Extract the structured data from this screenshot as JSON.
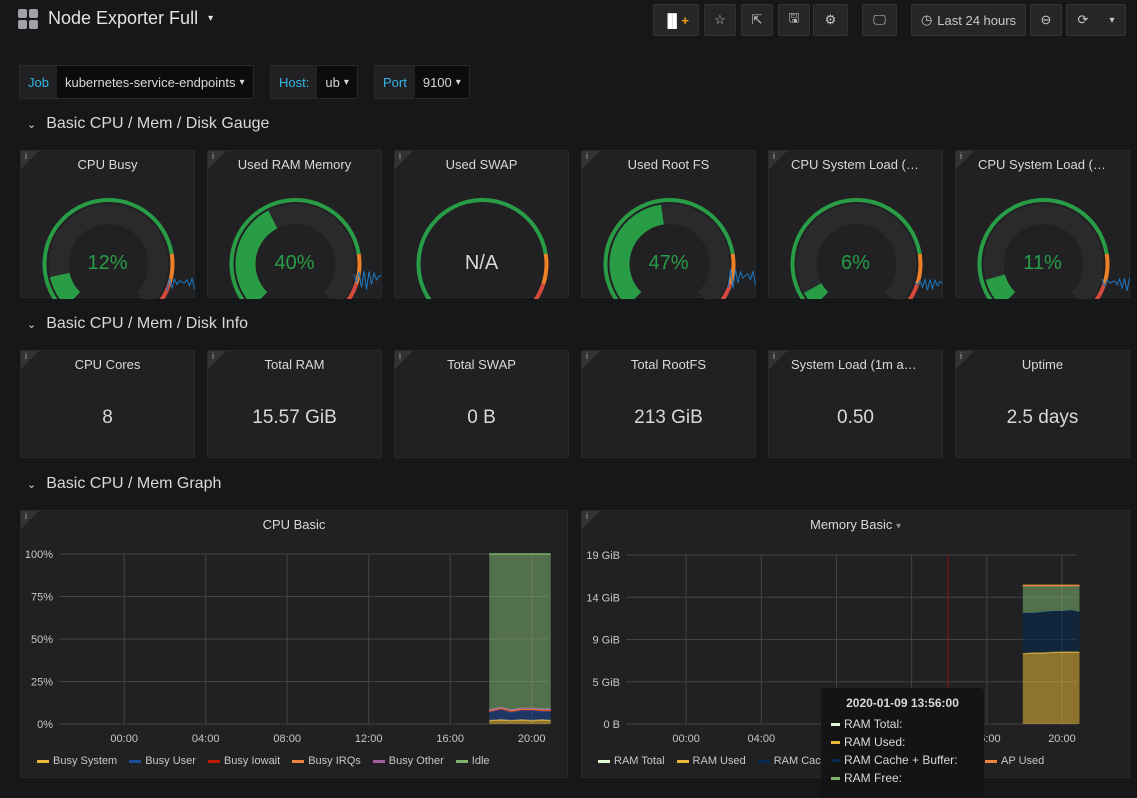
{
  "header": {
    "title": "Node Exporter Full",
    "time_range": "Last 24 hours",
    "buttons": [
      "add-panel",
      "star",
      "share",
      "save",
      "settings",
      "tv-mode"
    ]
  },
  "variables": [
    {
      "label": "Job",
      "value": "kubernetes-service-endpoints"
    },
    {
      "label": "Host:",
      "value": "ub"
    },
    {
      "label": "Port",
      "value": "9100"
    }
  ],
  "rows": [
    "Basic CPU / Mem / Disk Gauge",
    "Basic CPU / Mem / Disk Info",
    "Basic CPU / Mem Graph"
  ],
  "gauges": [
    {
      "title": "CPU Busy",
      "value": "12%",
      "percent": 12
    },
    {
      "title": "Used RAM Memory",
      "value": "40%",
      "percent": 40
    },
    {
      "title": "Used SWAP",
      "value": "N/A",
      "percent": null
    },
    {
      "title": "Used Root FS",
      "value": "47%",
      "percent": 47
    },
    {
      "title": "CPU System Load (1...",
      "value": "6%",
      "percent": 6
    },
    {
      "title": "CPU System Load (5...",
      "value": "11%",
      "percent": 11
    }
  ],
  "colors": {
    "green": "#299c46",
    "orange": "#ed8128",
    "red": "#d44a3a",
    "accent": "#33b5e5"
  },
  "stats": [
    {
      "title": "CPU Cores",
      "value": "8"
    },
    {
      "title": "Total RAM",
      "value": "15.57 GiB"
    },
    {
      "title": "Total SWAP",
      "value": "0 B"
    },
    {
      "title": "Total RootFS",
      "value": "213 GiB"
    },
    {
      "title": "System Load (1m avg)",
      "value": "0.50"
    },
    {
      "title": "Uptime",
      "value": "2.5 days"
    }
  ],
  "chart_data": [
    {
      "type": "area",
      "title": "CPU Basic",
      "ylim": [
        0,
        100
      ],
      "yticks": [
        "0%",
        "25%",
        "50%",
        "75%",
        "100%"
      ],
      "ytick_values": [
        0,
        25,
        50,
        75,
        100
      ],
      "xticks": [
        "00:00",
        "04:00",
        "08:00",
        "12:00",
        "16:00",
        "20:00"
      ],
      "xrange": [
        "20:48",
        "20:56"
      ],
      "stacked": true,
      "x": [
        "17:55",
        "18:30",
        "19:00",
        "19:30",
        "20:00",
        "20:30",
        "20:56"
      ],
      "series": [
        {
          "name": "Busy System",
          "color": "#eab839",
          "values": [
            2,
            2.5,
            2,
            2.5,
            2,
            2.5,
            2
          ]
        },
        {
          "name": "Busy User",
          "color": "#1f4b99",
          "values": [
            5,
            6,
            5,
            5.5,
            6,
            5,
            5.5
          ]
        },
        {
          "name": "Busy Iowait",
          "color": "#bf1b00",
          "values": [
            0.5,
            0.5,
            0.5,
            0.5,
            0.5,
            0.5,
            0.5
          ]
        },
        {
          "name": "Busy IRQs",
          "color": "#ef843c",
          "values": [
            0.3,
            0.3,
            0.3,
            0.3,
            0.3,
            0.3,
            0.3
          ]
        },
        {
          "name": "Busy Other",
          "color": "#a05da0",
          "values": [
            0.5,
            0.5,
            0.5,
            0.5,
            0.5,
            0.5,
            0.5
          ]
        },
        {
          "name": "Idle",
          "color": "#7eb26d",
          "values": [
            91.7,
            90.2,
            91.7,
            90.7,
            90.7,
            91.2,
            91.2
          ]
        }
      ]
    },
    {
      "type": "area",
      "title": "Memory Basic",
      "ylim": [
        0,
        19
      ],
      "yticks": [
        "0 B",
        "5 GiB",
        "9 GiB",
        "14 GiB",
        "19 GiB"
      ],
      "ytick_values": [
        0,
        4.75,
        9.5,
        14.25,
        19
      ],
      "xticks": [
        "00:00",
        "04:00",
        "08:00",
        "12:00",
        "16:00",
        "20:00"
      ],
      "stacked": true,
      "x": [
        "17:55",
        "18:30",
        "19:00",
        "19:30",
        "20:00",
        "20:30",
        "20:56"
      ],
      "series": [
        {
          "name": "RAM Total",
          "color": "#e0f9d7",
          "values": [
            15.57,
            15.57,
            15.57,
            15.57,
            15.57,
            15.57,
            15.57
          ]
        },
        {
          "name": "RAM Used",
          "color": "#eab839",
          "values": [
            7.9,
            8.0,
            8.0,
            8.05,
            8.1,
            8.1,
            8.1
          ]
        },
        {
          "name": "RAM Cache + Buffer",
          "color": "#052b51",
          "values": [
            4.6,
            4.5,
            4.6,
            4.65,
            4.6,
            4.7,
            4.5
          ]
        },
        {
          "name": "RAM Free",
          "color": "#7eb26d",
          "values": [
            3.07,
            3.07,
            2.97,
            2.87,
            2.87,
            2.77,
            2.97
          ]
        },
        {
          "name": "SWAP Used",
          "color": "#ef843c",
          "values": [
            0,
            0,
            0,
            0,
            0,
            0,
            0
          ]
        }
      ],
      "legend_visible": [
        "RAM Total",
        "RAM Used",
        "RAM Cache",
        "AP Used"
      ],
      "tooltip": {
        "time": "2020-01-09 13:56:00",
        "items": [
          "RAM Total:",
          "RAM Used:",
          "RAM Cache + Buffer:",
          "RAM Free:"
        ]
      }
    }
  ]
}
